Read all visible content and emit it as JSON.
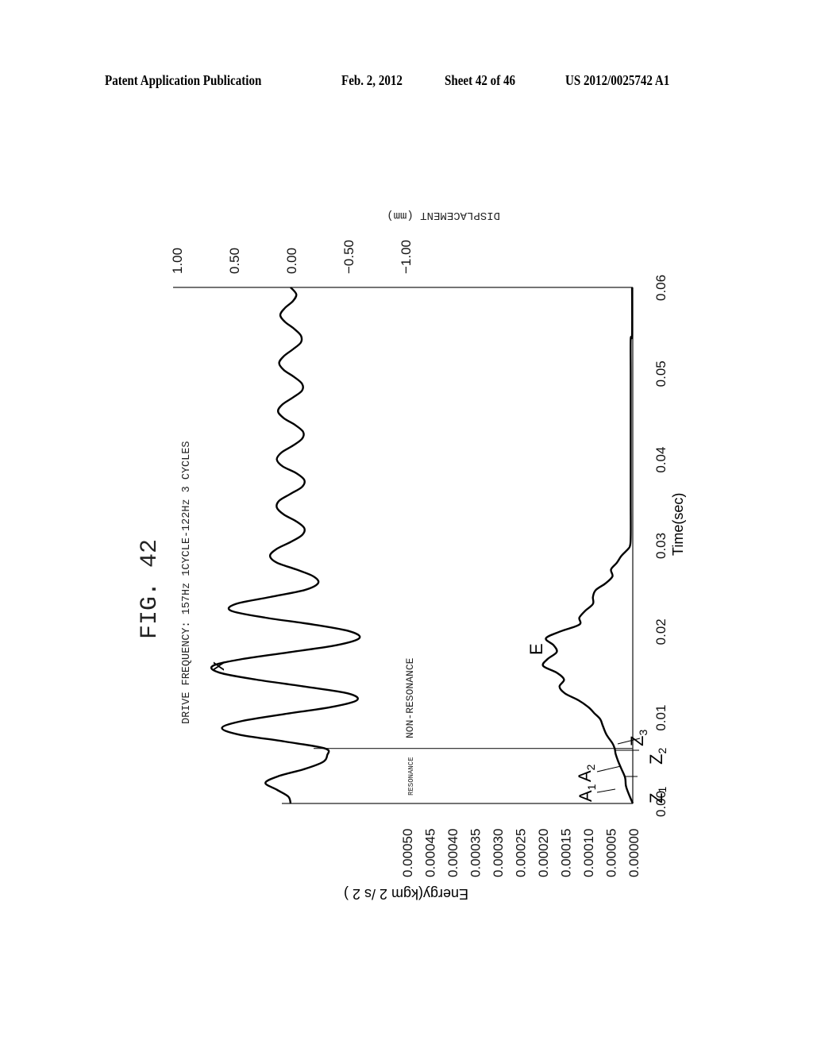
{
  "header": {
    "publication": "Patent Application Publication",
    "date": "Feb. 2, 2012",
    "sheet": "Sheet 42 of 46",
    "number": "US 2012/0025742 A1"
  },
  "figure": {
    "title": "FIG. 42",
    "subtitle": "DRIVE FREQUENCY: 157Hz 1CYCLE-122Hz 3 CYCLES",
    "orientation": "rotated 90° (time axis vertical)"
  },
  "chart_data": {
    "type": "line",
    "title": "FIG. 42",
    "subtitle": "DRIVE FREQUENCY: 157Hz 1CYCLE-122Hz 3 CYCLES",
    "xlabel": "Time(sec)",
    "xlim": [
      0.0,
      0.06
    ],
    "xticks": [
      "0.00",
      "0.01",
      "0.02",
      "0.03",
      "0.04",
      "0.05",
      "0.06"
    ],
    "ylabel_left": "Energy(kgm 2 /s 2 )",
    "ylim_left": [
      0.0,
      0.0005
    ],
    "yticks_left": [
      "0.00000",
      "0.00005",
      "0.00010",
      "0.00015",
      "0.00020",
      "0.00025",
      "0.00030",
      "0.00035",
      "0.00040",
      "0.00045",
      "0.00050"
    ],
    "ylabel_right": "DISPLACEMENT (mm)",
    "ylim_right": [
      -1.0,
      1.0
    ],
    "yticks_right": [
      "1.00",
      "0.50",
      "0.00",
      "-0.50",
      "-1.00"
    ],
    "resonance_boundary_time": 0.0064,
    "region_labels": {
      "resonance": "RESONANCE",
      "non_resonance": "NON-RESONANCE"
    },
    "grid": false,
    "series": [
      {
        "name": "X",
        "axis": "displacement",
        "x": [
          0.0,
          0.0008,
          0.0016,
          0.0024,
          0.0032,
          0.004,
          0.0048,
          0.0056,
          0.0064,
          0.0072,
          0.008,
          0.0088,
          0.0096,
          0.0104,
          0.0112,
          0.012,
          0.0128,
          0.0136,
          0.0144,
          0.0152,
          0.016,
          0.0168,
          0.0176,
          0.0184,
          0.0192,
          0.02,
          0.0208,
          0.0216,
          0.0224,
          0.0232,
          0.024,
          0.0248,
          0.0256,
          0.0264,
          0.0272,
          0.028,
          0.0288,
          0.0296,
          0.0304,
          0.0312,
          0.032,
          0.0328,
          0.0336,
          0.0344,
          0.0352,
          0.036,
          0.0368,
          0.0376,
          0.0384,
          0.0392,
          0.04,
          0.0408,
          0.0416,
          0.0424,
          0.0432,
          0.044,
          0.0448,
          0.0456,
          0.0464,
          0.0472,
          0.048,
          0.0488,
          0.0496,
          0.0504,
          0.0512,
          0.052,
          0.0528,
          0.0536,
          0.0544,
          0.0552,
          0.056,
          0.0568,
          0.0576,
          0.0584,
          0.0592,
          0.06
        ],
        "values": [
          0.0,
          0.02,
          0.12,
          0.22,
          0.1,
          -0.12,
          -0.28,
          -0.32,
          -0.3,
          0.05,
          0.45,
          0.6,
          0.42,
          0.05,
          -0.35,
          -0.58,
          -0.5,
          -0.12,
          0.3,
          0.62,
          0.68,
          0.42,
          0.0,
          -0.4,
          -0.6,
          -0.52,
          -0.2,
          0.22,
          0.52,
          0.48,
          0.18,
          -0.12,
          -0.24,
          -0.2,
          -0.05,
          0.12,
          0.18,
          0.12,
          0.0,
          -0.1,
          -0.12,
          -0.05,
          0.06,
          0.12,
          0.1,
          0.0,
          -0.1,
          -0.12,
          -0.05,
          0.07,
          0.12,
          0.08,
          -0.02,
          -0.1,
          -0.11,
          -0.04,
          0.06,
          0.11,
          0.07,
          -0.02,
          -0.1,
          -0.1,
          -0.03,
          0.06,
          0.1,
          0.06,
          -0.02,
          -0.09,
          -0.09,
          -0.03,
          0.05,
          0.09,
          0.05,
          -0.02,
          -0.05,
          0.0
        ]
      },
      {
        "name": "E",
        "axis": "energy",
        "x": [
          0.0,
          0.001,
          0.002,
          0.003,
          0.004,
          0.005,
          0.0058,
          0.0064,
          0.007,
          0.008,
          0.009,
          0.0098,
          0.0105,
          0.0112,
          0.012,
          0.0128,
          0.0136,
          0.0144,
          0.0152,
          0.016,
          0.0168,
          0.0176,
          0.0184,
          0.0192,
          0.02,
          0.0208,
          0.0216,
          0.0224,
          0.0232,
          0.024,
          0.0248,
          0.0256,
          0.0264,
          0.0272,
          0.028,
          0.0288,
          0.0296,
          0.03,
          0.031,
          0.035,
          0.04,
          0.045,
          0.05,
          0.054,
          0.0545,
          0.06
        ],
        "values": [
          0.0,
          8e-06,
          1.5e-05,
          1.7e-05,
          2.5e-05,
          3.3e-05,
          3.8e-05,
          4e-05,
          4.5e-05,
          5.8e-05,
          6.6e-05,
          7.2e-05,
          8.5e-05,
          9.8e-05,
          0.00012,
          0.00015,
          0.000162,
          0.000152,
          0.000168,
          0.000198,
          0.000188,
          0.000168,
          0.000175,
          0.000192,
          0.00016,
          0.000118,
          0.000118,
          0.000105,
          8.8e-05,
          8.8e-05,
          8.2e-05,
          6e-05,
          4.5e-05,
          4.8e-05,
          3.5e-05,
          2.5e-05,
          1e-05,
          6e-06,
          4.5e-06,
          4.5e-06,
          4.5e-06,
          4.5e-06,
          4.5e-06,
          4.5e-06,
          1.5e-06,
          1.5e-06
        ]
      }
    ],
    "annotations": [
      "X",
      "E",
      "A1",
      "A2",
      "Z1",
      "Z2",
      "Z3"
    ]
  }
}
